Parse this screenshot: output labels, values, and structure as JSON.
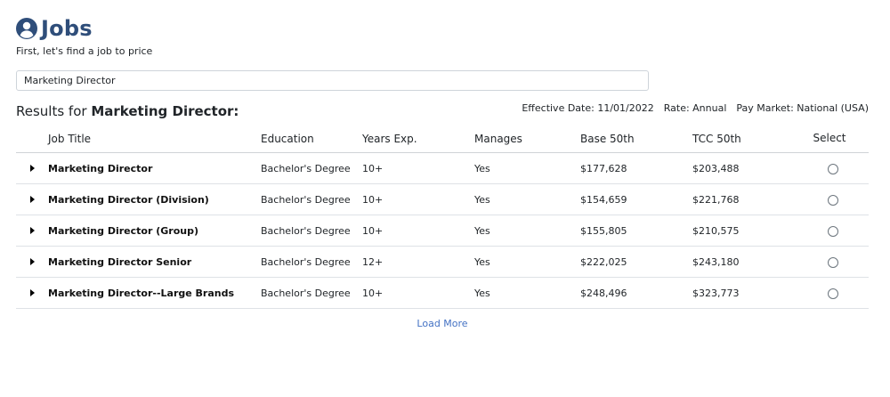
{
  "header": {
    "title": "Jobs",
    "icon": "user-circle-icon",
    "accent_color": "#2f4e7a",
    "subtitle": "First, let's find a job to price"
  },
  "search": {
    "value": "Marketing Director",
    "placeholder": ""
  },
  "results": {
    "prefix": "Results for",
    "query": "Marketing Director:",
    "effective_date": "Effective Date: 11/01/2022",
    "rate": "Rate: Annual",
    "pay_market": "Pay Market: National (USA)"
  },
  "table": {
    "columns": [
      "Job Title",
      "Education",
      "Years Exp.",
      "Manages",
      "Base 50th",
      "TCC 50th",
      "Select"
    ],
    "rows": [
      {
        "title": "Marketing Director",
        "education": "Bachelor's Degree",
        "years": "10+",
        "manages": "Yes",
        "base": "$177,628",
        "tcc": "$203,488"
      },
      {
        "title": "Marketing Director (Division)",
        "education": "Bachelor's Degree",
        "years": "10+",
        "manages": "Yes",
        "base": "$154,659",
        "tcc": "$221,768"
      },
      {
        "title": "Marketing Director (Group)",
        "education": "Bachelor's Degree",
        "years": "10+",
        "manages": "Yes",
        "base": "$155,805",
        "tcc": "$210,575"
      },
      {
        "title": "Marketing Director Senior",
        "education": "Bachelor's Degree",
        "years": "12+",
        "manages": "Yes",
        "base": "$222,025",
        "tcc": "$243,180"
      },
      {
        "title": "Marketing Director--Large Brands",
        "education": "Bachelor's Degree",
        "years": "10+",
        "manages": "Yes",
        "base": "$248,496",
        "tcc": "$323,773"
      }
    ]
  },
  "load_more_label": "Load More",
  "link_color": "#4472c4"
}
